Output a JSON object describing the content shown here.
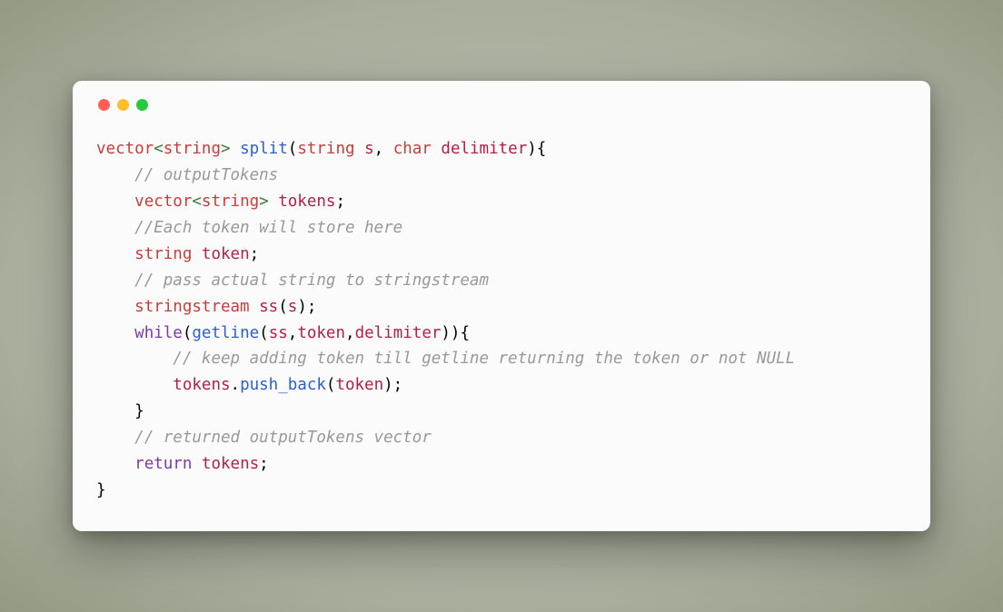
{
  "tokens": [
    [
      {
        "t": "vector",
        "c": "kw-type"
      },
      {
        "t": "<",
        "c": "angle"
      },
      {
        "t": "string",
        "c": "kw-type"
      },
      {
        "t": ">",
        "c": "angle"
      },
      {
        "t": " ",
        "c": "punct"
      },
      {
        "t": "split",
        "c": "fn"
      },
      {
        "t": "(",
        "c": "punct"
      },
      {
        "t": "string",
        "c": "kw-type"
      },
      {
        "t": " ",
        "c": "punct"
      },
      {
        "t": "s",
        "c": "ident"
      },
      {
        "t": ", ",
        "c": "punct"
      },
      {
        "t": "char",
        "c": "kw-type"
      },
      {
        "t": " ",
        "c": "punct"
      },
      {
        "t": "delimiter",
        "c": "ident"
      },
      {
        "t": "){",
        "c": "punct"
      }
    ],
    [
      {
        "t": "    ",
        "c": "punct"
      },
      {
        "t": "// outputTokens",
        "c": "comment"
      }
    ],
    [
      {
        "t": "    ",
        "c": "punct"
      },
      {
        "t": "vector",
        "c": "kw-type"
      },
      {
        "t": "<",
        "c": "angle"
      },
      {
        "t": "string",
        "c": "kw-type"
      },
      {
        "t": ">",
        "c": "angle"
      },
      {
        "t": " ",
        "c": "punct"
      },
      {
        "t": "tokens",
        "c": "ident"
      },
      {
        "t": ";",
        "c": "punct"
      }
    ],
    [
      {
        "t": "    ",
        "c": "punct"
      },
      {
        "t": "//Each token will store here",
        "c": "comment"
      }
    ],
    [
      {
        "t": "    ",
        "c": "punct"
      },
      {
        "t": "string",
        "c": "kw-type"
      },
      {
        "t": " ",
        "c": "punct"
      },
      {
        "t": "token",
        "c": "ident"
      },
      {
        "t": ";",
        "c": "punct"
      }
    ],
    [
      {
        "t": "    ",
        "c": "punct"
      },
      {
        "t": "// pass actual string to stringstream",
        "c": "comment"
      }
    ],
    [
      {
        "t": "    ",
        "c": "punct"
      },
      {
        "t": "stringstream",
        "c": "kw-type"
      },
      {
        "t": " ",
        "c": "punct"
      },
      {
        "t": "ss",
        "c": "ident"
      },
      {
        "t": "(",
        "c": "punct"
      },
      {
        "t": "s",
        "c": "ident"
      },
      {
        "t": ");",
        "c": "punct"
      }
    ],
    [
      {
        "t": "    ",
        "c": "punct"
      },
      {
        "t": "while",
        "c": "kw-ctrl"
      },
      {
        "t": "(",
        "c": "punct"
      },
      {
        "t": "getline",
        "c": "fn"
      },
      {
        "t": "(",
        "c": "punct"
      },
      {
        "t": "ss",
        "c": "ident"
      },
      {
        "t": ",",
        "c": "punct"
      },
      {
        "t": "token",
        "c": "ident"
      },
      {
        "t": ",",
        "c": "punct"
      },
      {
        "t": "delimiter",
        "c": "ident"
      },
      {
        "t": ")){",
        "c": "punct"
      }
    ],
    [
      {
        "t": "        ",
        "c": "punct"
      },
      {
        "t": "// keep adding token till getline returning the token or not NULL",
        "c": "comment"
      }
    ],
    [
      {
        "t": "        ",
        "c": "punct"
      },
      {
        "t": "tokens",
        "c": "ident"
      },
      {
        "t": ".",
        "c": "punct"
      },
      {
        "t": "push_back",
        "c": "fn"
      },
      {
        "t": "(",
        "c": "punct"
      },
      {
        "t": "token",
        "c": "ident"
      },
      {
        "t": ");",
        "c": "punct"
      }
    ],
    [
      {
        "t": "    }",
        "c": "punct"
      }
    ],
    [
      {
        "t": "    ",
        "c": "punct"
      },
      {
        "t": "// returned outputTokens vector",
        "c": "comment"
      }
    ],
    [
      {
        "t": "    ",
        "c": "punct"
      },
      {
        "t": "return",
        "c": "kw-ctrl"
      },
      {
        "t": " ",
        "c": "punct"
      },
      {
        "t": "tokens",
        "c": "ident"
      },
      {
        "t": ";",
        "c": "punct"
      }
    ],
    [
      {
        "t": "}",
        "c": "punct"
      }
    ]
  ]
}
